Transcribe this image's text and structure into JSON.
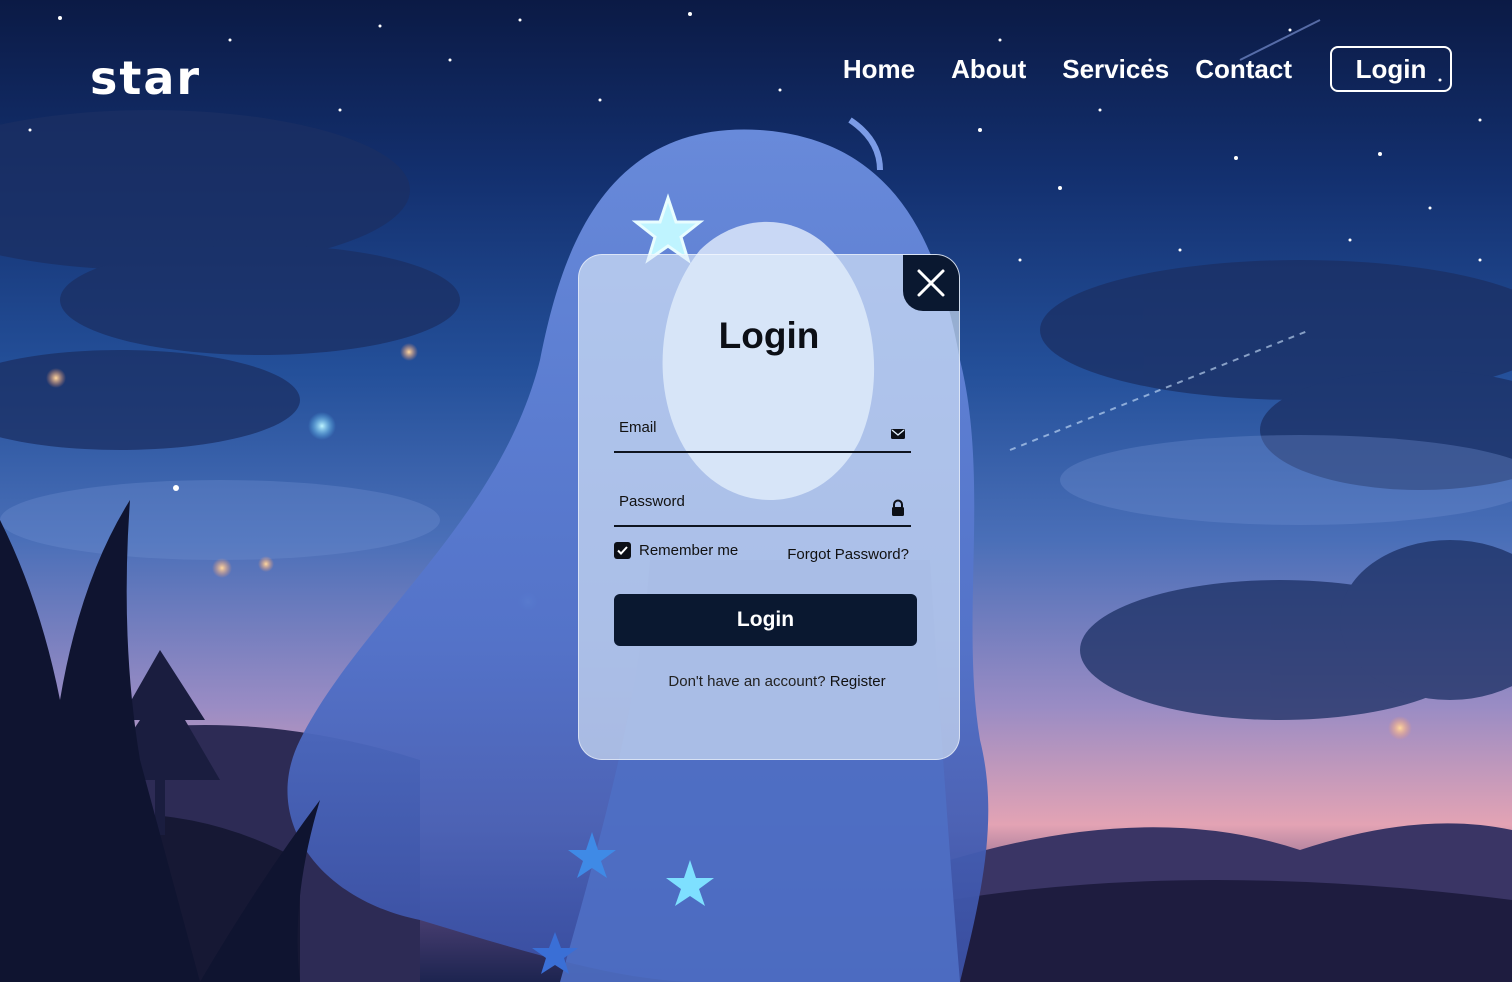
{
  "brand": {
    "logo_text": "star"
  },
  "nav": {
    "links": [
      {
        "label": "Home"
      },
      {
        "label": "About"
      },
      {
        "label": "Services"
      },
      {
        "label": "Contact"
      }
    ],
    "login_button": "Login"
  },
  "login_card": {
    "title": "Login",
    "email": {
      "placeholder": "Email",
      "value": "",
      "icon": "mail-icon"
    },
    "password": {
      "placeholder": "Password",
      "value": "",
      "icon": "lock-icon"
    },
    "remember_me": {
      "label": "Remember me",
      "checked": true
    },
    "forgot_password": "Forgot Password?",
    "submit_label": "Login",
    "register_prompt": "Don't have an account?",
    "register_link": "Register",
    "close_icon": "close-icon"
  },
  "colors": {
    "primary_dark": "#0a1830",
    "card_glass": "#e1eefa",
    "text_light": "#ffffff"
  }
}
